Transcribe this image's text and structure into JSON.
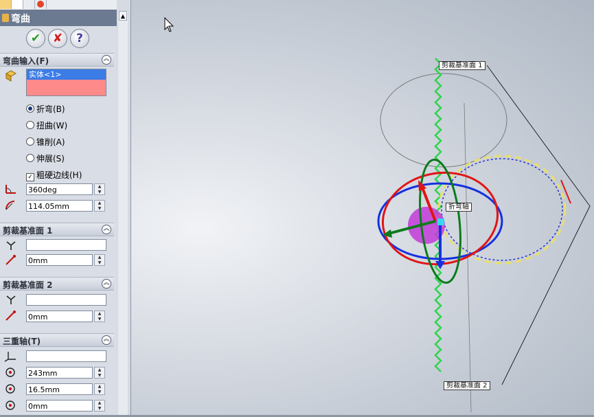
{
  "feature": {
    "title": "弯曲"
  },
  "actions": {
    "ok": "✔",
    "cancel": "✘",
    "help": "?"
  },
  "bend_input": {
    "header": "弯曲输入(F)",
    "bodies": [
      "实体<1>"
    ],
    "options": [
      {
        "label": "折弯(B)",
        "selected": true
      },
      {
        "label": "扭曲(W)",
        "selected": false
      },
      {
        "label": "锥削(A)",
        "selected": false
      },
      {
        "label": "伸展(S)",
        "selected": false
      }
    ],
    "hard_edges": {
      "label": "粗硬边线(H)",
      "checked": true
    },
    "angle": "360deg",
    "radius": "114.05mm"
  },
  "trim_plane_1": {
    "header": "剪裁基准面 1",
    "reference": "",
    "distance": "0mm"
  },
  "trim_plane_2": {
    "header": "剪裁基准面 2",
    "reference": "",
    "distance": "0mm"
  },
  "triad": {
    "header": "三重轴(T)",
    "reference": "",
    "x": "243mm",
    "y": "16.5mm",
    "z": "0mm"
  },
  "viewport": {
    "label_plane1": "剪裁基准面 1",
    "label_plane2": "剪裁基准面 2",
    "label_bend_axis": "折弯轴"
  },
  "colors": {
    "x_axis": "#e01515",
    "y_axis": "#1530e0",
    "z_axis": "#0d7a1c",
    "body_highlight": "#ff8a8a",
    "bend_sphere": "#c23bd8"
  }
}
